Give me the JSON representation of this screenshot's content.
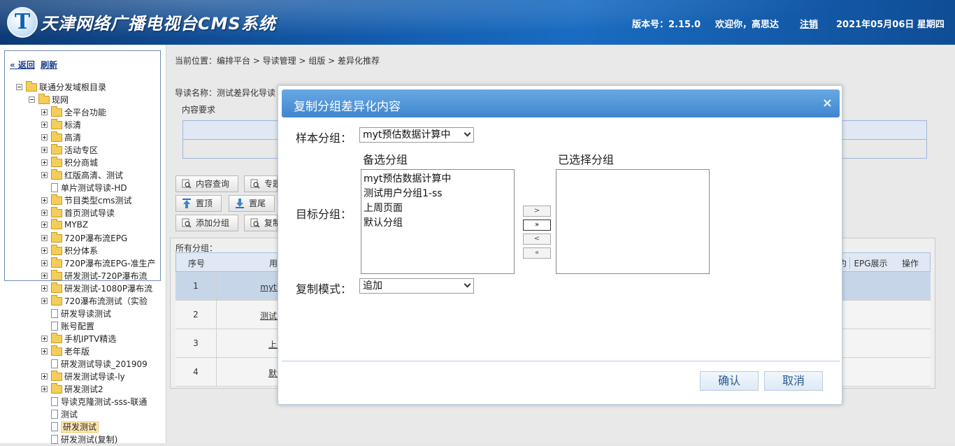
{
  "header": {
    "logo_letter": "T",
    "title": "天津网络广播电视台CMS系统",
    "version": "版本号：2.15.0",
    "welcome": "欢迎你，高思达",
    "logout": "注销",
    "date": "2021年05月06日 星期四"
  },
  "sidebar": {
    "back": "« 返回",
    "refresh": "刷新",
    "tree": [
      {
        "label": "联通分发域根目录",
        "level": 0,
        "type": "folder",
        "expander": "minus"
      },
      {
        "label": "现网",
        "level": 1,
        "type": "folder",
        "expander": "minus"
      },
      {
        "label": "全平台功能",
        "level": 2,
        "type": "folder",
        "expander": "plus"
      },
      {
        "label": "标清",
        "level": 2,
        "type": "folder",
        "expander": "plus"
      },
      {
        "label": "高清",
        "level": 2,
        "type": "folder",
        "expander": "plus"
      },
      {
        "label": "活动专区",
        "level": 2,
        "type": "folder",
        "expander": "plus"
      },
      {
        "label": "积分商城",
        "level": 2,
        "type": "folder",
        "expander": "plus"
      },
      {
        "label": "红版高清、测试",
        "level": 2,
        "type": "folder",
        "expander": "plus"
      },
      {
        "label": "单片测试导读-HD",
        "level": 2,
        "type": "doc",
        "expander": "none"
      },
      {
        "label": "节目类型cms测试",
        "level": 2,
        "type": "folder",
        "expander": "plus"
      },
      {
        "label": "首页测试导读",
        "level": 2,
        "type": "folder",
        "expander": "plus"
      },
      {
        "label": "MYBZ",
        "level": 2,
        "type": "folder",
        "expander": "plus"
      },
      {
        "label": "720P瀑布流EPG",
        "level": 2,
        "type": "folder",
        "expander": "plus"
      },
      {
        "label": "积分体系",
        "level": 2,
        "type": "folder",
        "expander": "plus"
      },
      {
        "label": "720P瀑布流EPG-准生产",
        "level": 2,
        "type": "folder",
        "expander": "plus"
      },
      {
        "label": "研发测试-720P瀑布流",
        "level": 2,
        "type": "folder",
        "expander": "plus"
      },
      {
        "label": "研发测试-1080P瀑布流",
        "level": 2,
        "type": "folder",
        "expander": "plus"
      },
      {
        "label": "720瀑布流测试（实验",
        "level": 2,
        "type": "folder",
        "expander": "plus"
      },
      {
        "label": "研发导读测试",
        "level": 2,
        "type": "doc",
        "expander": "none"
      },
      {
        "label": "账号配置",
        "level": 2,
        "type": "doc",
        "expander": "none"
      },
      {
        "label": "手机IPTV精选",
        "level": 2,
        "type": "folder",
        "expander": "plus"
      },
      {
        "label": "老年版",
        "level": 2,
        "type": "folder",
        "expander": "plus"
      },
      {
        "label": "研发测试导读_201909",
        "level": 2,
        "type": "doc",
        "expander": "none"
      },
      {
        "label": "研发测试导读-ly",
        "level": 2,
        "type": "folder",
        "expander": "plus"
      },
      {
        "label": "研发测试2",
        "level": 2,
        "type": "folder",
        "expander": "plus"
      },
      {
        "label": "导读克隆测试-sss-联通",
        "level": 2,
        "type": "doc",
        "expander": "none"
      },
      {
        "label": "测试",
        "level": 2,
        "type": "doc",
        "expander": "none"
      },
      {
        "label": "研发测试",
        "level": 2,
        "type": "doc",
        "expander": "none",
        "selected": true
      },
      {
        "label": "研发测试(复制)",
        "level": 2,
        "type": "doc",
        "expander": "none"
      }
    ]
  },
  "main": {
    "breadcrumb": "当前位置：编排平台 > 导读管理 > 组版 > 差异化推荐",
    "guide_name": "导读名称：测试差异化导读",
    "content_req": "内容要求",
    "buttons": {
      "content_query": "内容查询",
      "topic": "专题",
      "top": "置顶",
      "bottom": "置尾",
      "add_group": "添加分组",
      "copy": "复制"
    },
    "group_caption": "所有分组：",
    "columns": {
      "no": "序号",
      "user": "用户",
      "epg_col": "约",
      "epg_show": "EPG展示",
      "op": "操作"
    },
    "rows": [
      {
        "no": "1",
        "name": "myt预估"
      },
      {
        "no": "2",
        "name": "测试用户"
      },
      {
        "no": "3",
        "name": "上周"
      },
      {
        "no": "4",
        "name": "默认"
      }
    ]
  },
  "modal": {
    "title": "复制分组差异化内容",
    "close": "×",
    "sample_label": "样本分组：",
    "sample_value": "myt预估数据计算中",
    "target_label": "目标分组：",
    "available_head": "备选分组",
    "selected_head": "已选择分组",
    "available": [
      "myt预估数据计算中",
      "测试用户分组1-ss",
      "上周页面",
      "默认分组"
    ],
    "selected": [],
    "move_buttons": [
      ">",
      "»",
      "<",
      "«"
    ],
    "mode_label": "复制模式：",
    "mode_value": "追加",
    "confirm": "确认",
    "cancel": "取消"
  },
  "colors": {
    "header_blue": "#1158a8",
    "title_bar": "#4a8fd6",
    "selected_row": "#c6d6e8"
  }
}
